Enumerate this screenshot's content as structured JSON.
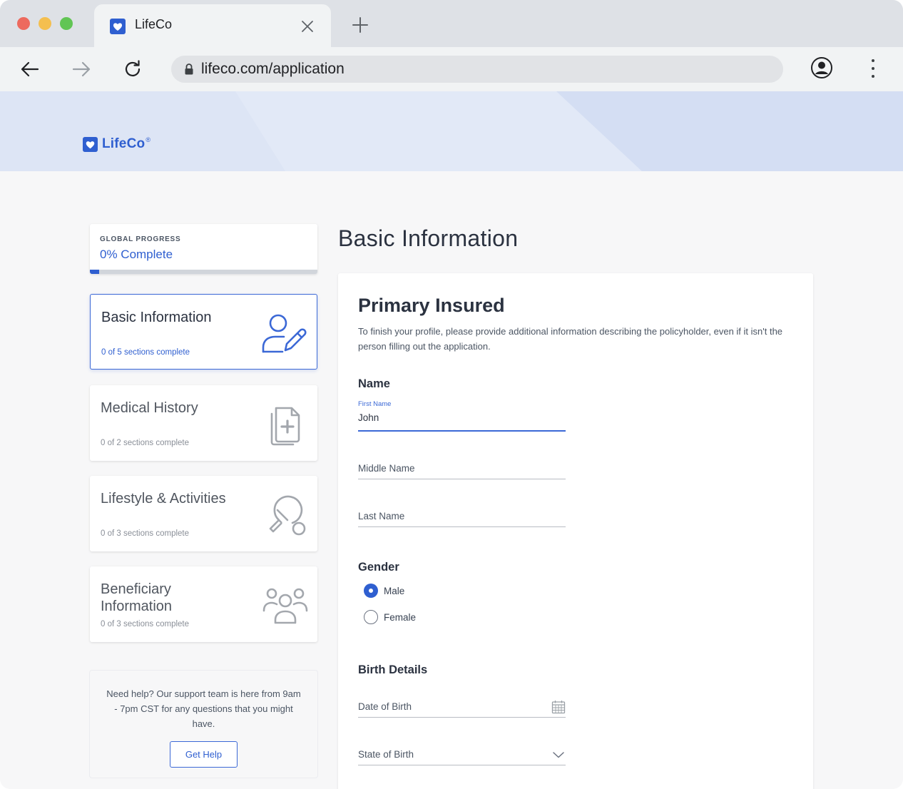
{
  "browser": {
    "tab_title": "LifeCo",
    "url": "lifeco.com/application"
  },
  "brand": {
    "name": "LifeCo",
    "registered": "®",
    "color": "#2f5fd0"
  },
  "progress": {
    "label": "GLOBAL PROGRESS",
    "value_text": "0% Complete",
    "fraction": 0.04
  },
  "sections": [
    {
      "title": "Basic Information",
      "subtitle": "0 of 5 sections complete",
      "icon": "user-edit-icon"
    },
    {
      "title": "Medical History",
      "subtitle": "0 of 2 sections complete",
      "icon": "medical-document-icon"
    },
    {
      "title": "Lifestyle & Activities",
      "subtitle": "0 of 3 sections complete",
      "icon": "ping-pong-icon"
    },
    {
      "title": "Beneficiary Information",
      "subtitle": "0 of 3 sections complete",
      "icon": "group-icon"
    }
  ],
  "help": {
    "text": "Need help? Our support team is here from 9am - 7pm CST for any questions that you might have.",
    "button_label": "Get Help"
  },
  "main": {
    "page_title": "Basic Information",
    "form_title": "Primary Insured",
    "description": "To finish your profile, please provide additional information describing the policyholder, even if it isn't the person filling out the application.",
    "name_group": {
      "label": "Name",
      "first_name_label": "First Name",
      "first_name_value": "John",
      "middle_name_placeholder": "Middle Name",
      "last_name_placeholder": "Last Name"
    },
    "gender_group": {
      "label": "Gender",
      "options": [
        "Male",
        "Female"
      ],
      "selected": "Male"
    },
    "birth_group": {
      "label": "Birth Details",
      "dob_placeholder": "Date of Birth",
      "state_placeholder": "State of Birth"
    }
  }
}
